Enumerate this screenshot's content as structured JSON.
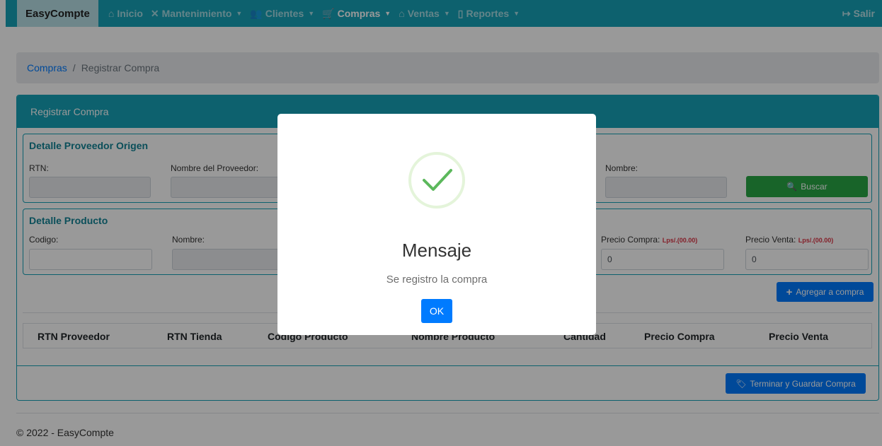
{
  "navbar": {
    "brand": "EasyCompte",
    "items": [
      {
        "label": "Inicio",
        "icon": "home-icon",
        "dropdown": false,
        "active": false
      },
      {
        "label": "Mantenimiento",
        "icon": "tools-icon",
        "dropdown": true,
        "active": false
      },
      {
        "label": "Clientes",
        "icon": "users-icon",
        "dropdown": true,
        "active": false
      },
      {
        "label": "Compras",
        "icon": "cart-icon",
        "dropdown": true,
        "active": true
      },
      {
        "label": "Ventas",
        "icon": "store-icon",
        "dropdown": true,
        "active": false
      },
      {
        "label": "Reportes",
        "icon": "document-icon",
        "dropdown": true,
        "active": false
      }
    ],
    "logout": "Salir"
  },
  "breadcrumb": {
    "link": "Compras",
    "separator": "/",
    "current": "Registrar Compra"
  },
  "card": {
    "title": "Registrar Compra",
    "proveedor": {
      "legend": "Detalle Proveedor Origen",
      "rtn_label": "RTN:",
      "nombre_proveedor_label": "Nombre del Proveedor:",
      "nombre_label": "Nombre:",
      "buscar": "Buscar"
    },
    "producto": {
      "legend": "Detalle Producto",
      "codigo_label": "Codigo:",
      "nombre_label": "Nombre:",
      "precio_compra_label": "Precio Compra:",
      "precio_compra_hint": "Lps/.(00.00)",
      "precio_compra_value": "0",
      "precio_venta_label": "Precio Venta:",
      "precio_venta_hint": "Lps/.(00.00)",
      "precio_venta_value": "0"
    },
    "agregar": "Agregar a compra",
    "table_headers": [
      "RTN Proveedor",
      "RTN Tienda",
      "Codigo Producto",
      "Nombre Producto",
      "Cantidad",
      "Precio Compra",
      "Precio Venta"
    ],
    "terminar": "Terminar y Guardar Compra"
  },
  "footer": "© 2022 - EasyCompte",
  "modal": {
    "title": "Mensaje",
    "text": "Se registro la compra",
    "ok": "OK"
  },
  "colors": {
    "primary": "#17a2b8",
    "success": "#28a745",
    "blue": "#007bff"
  }
}
